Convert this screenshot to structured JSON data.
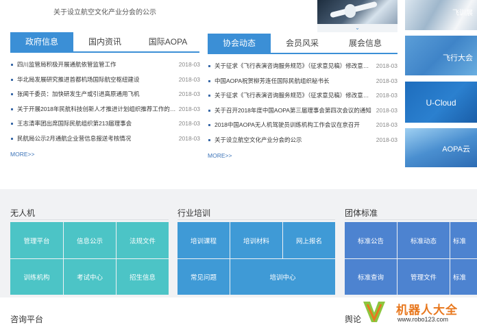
{
  "top_note": "关于设立航空文化产业分会的公示",
  "banner": {
    "pager": "⌄"
  },
  "left_panel": {
    "tabs": [
      "政府信息",
      "国内资讯",
      "国际AOPA"
    ],
    "items": [
      {
        "title": "四川监管局积极开展通航依管监管工作",
        "date": "2018-03"
      },
      {
        "title": "华北局发展研究推进首都机场国际航空枢纽建设",
        "date": "2018-03"
      },
      {
        "title": "张闻千委员：加快研发生产或引进高原通用飞机",
        "date": "2018-03"
      },
      {
        "title": "关于开展2018年民航科技创新人才推进计划组织推荐工作的…",
        "date": "2018-03"
      },
      {
        "title": "王志清率团出席国际民航组织第213届理事会",
        "date": "2018-03"
      },
      {
        "title": "民航局公示2月通航企业营信息报送考核情况",
        "date": "2018-03"
      }
    ],
    "more": "MORE>>"
  },
  "mid_panel": {
    "tabs": [
      "协会动态",
      "会员风采",
      "展会信息"
    ],
    "items": [
      {
        "title": "关于征求《飞行表演咨询服务规范》（征求意见稿）修改意…",
        "date": "2018-03"
      },
      {
        "title": "中国AOPA祝贺柳芳连任国际民航组织秘书长",
        "date": "2018-03"
      },
      {
        "title": "关于征求《飞行表演咨询服务规范》（征求意见稿）修改意见…",
        "date": "2018-03"
      },
      {
        "title": "关于召开2018年度中国AOPA第三届理事会第四次会议的通知",
        "date": "2018-03"
      },
      {
        "title": "2018中国AOPA无人机驾驶员训练机构工作会议在京召开",
        "date": "2018-03"
      },
      {
        "title": "关于设立航空文化产业分会的公示",
        "date": "2018-03"
      }
    ],
    "more": "MORE>>"
  },
  "side_tiles": [
    {
      "label": "飞训展"
    },
    {
      "label": "飞行大会"
    },
    {
      "label": "U-Cloud"
    },
    {
      "label": "AOPA云"
    }
  ],
  "sections": {
    "drone": {
      "title": "无人机",
      "cells": [
        "管理平台",
        "信息公示",
        "法规文件",
        "训练机构",
        "考试中心",
        "招生信息"
      ]
    },
    "training": {
      "title": "行业培训",
      "cells": [
        "培训课程",
        "培训材料",
        "网上报名",
        "常见问题",
        "培训中心"
      ]
    },
    "standards": {
      "title": "团体标准",
      "cells": [
        "标准公告",
        "标准动态",
        "标准",
        "标准查询",
        "管理文件",
        "标准"
      ]
    }
  },
  "bottom": {
    "consult": "咨询平台",
    "opinion": "舆论"
  },
  "watermark": {
    "text": "机器人大全",
    "url": "www.robo123.com"
  },
  "colors": {
    "accent": "#3b8fd6",
    "teal": "#4cc4c6",
    "blue": "#3f9ad6",
    "indigo": "#4d83d0",
    "orange": "#e8781e"
  }
}
